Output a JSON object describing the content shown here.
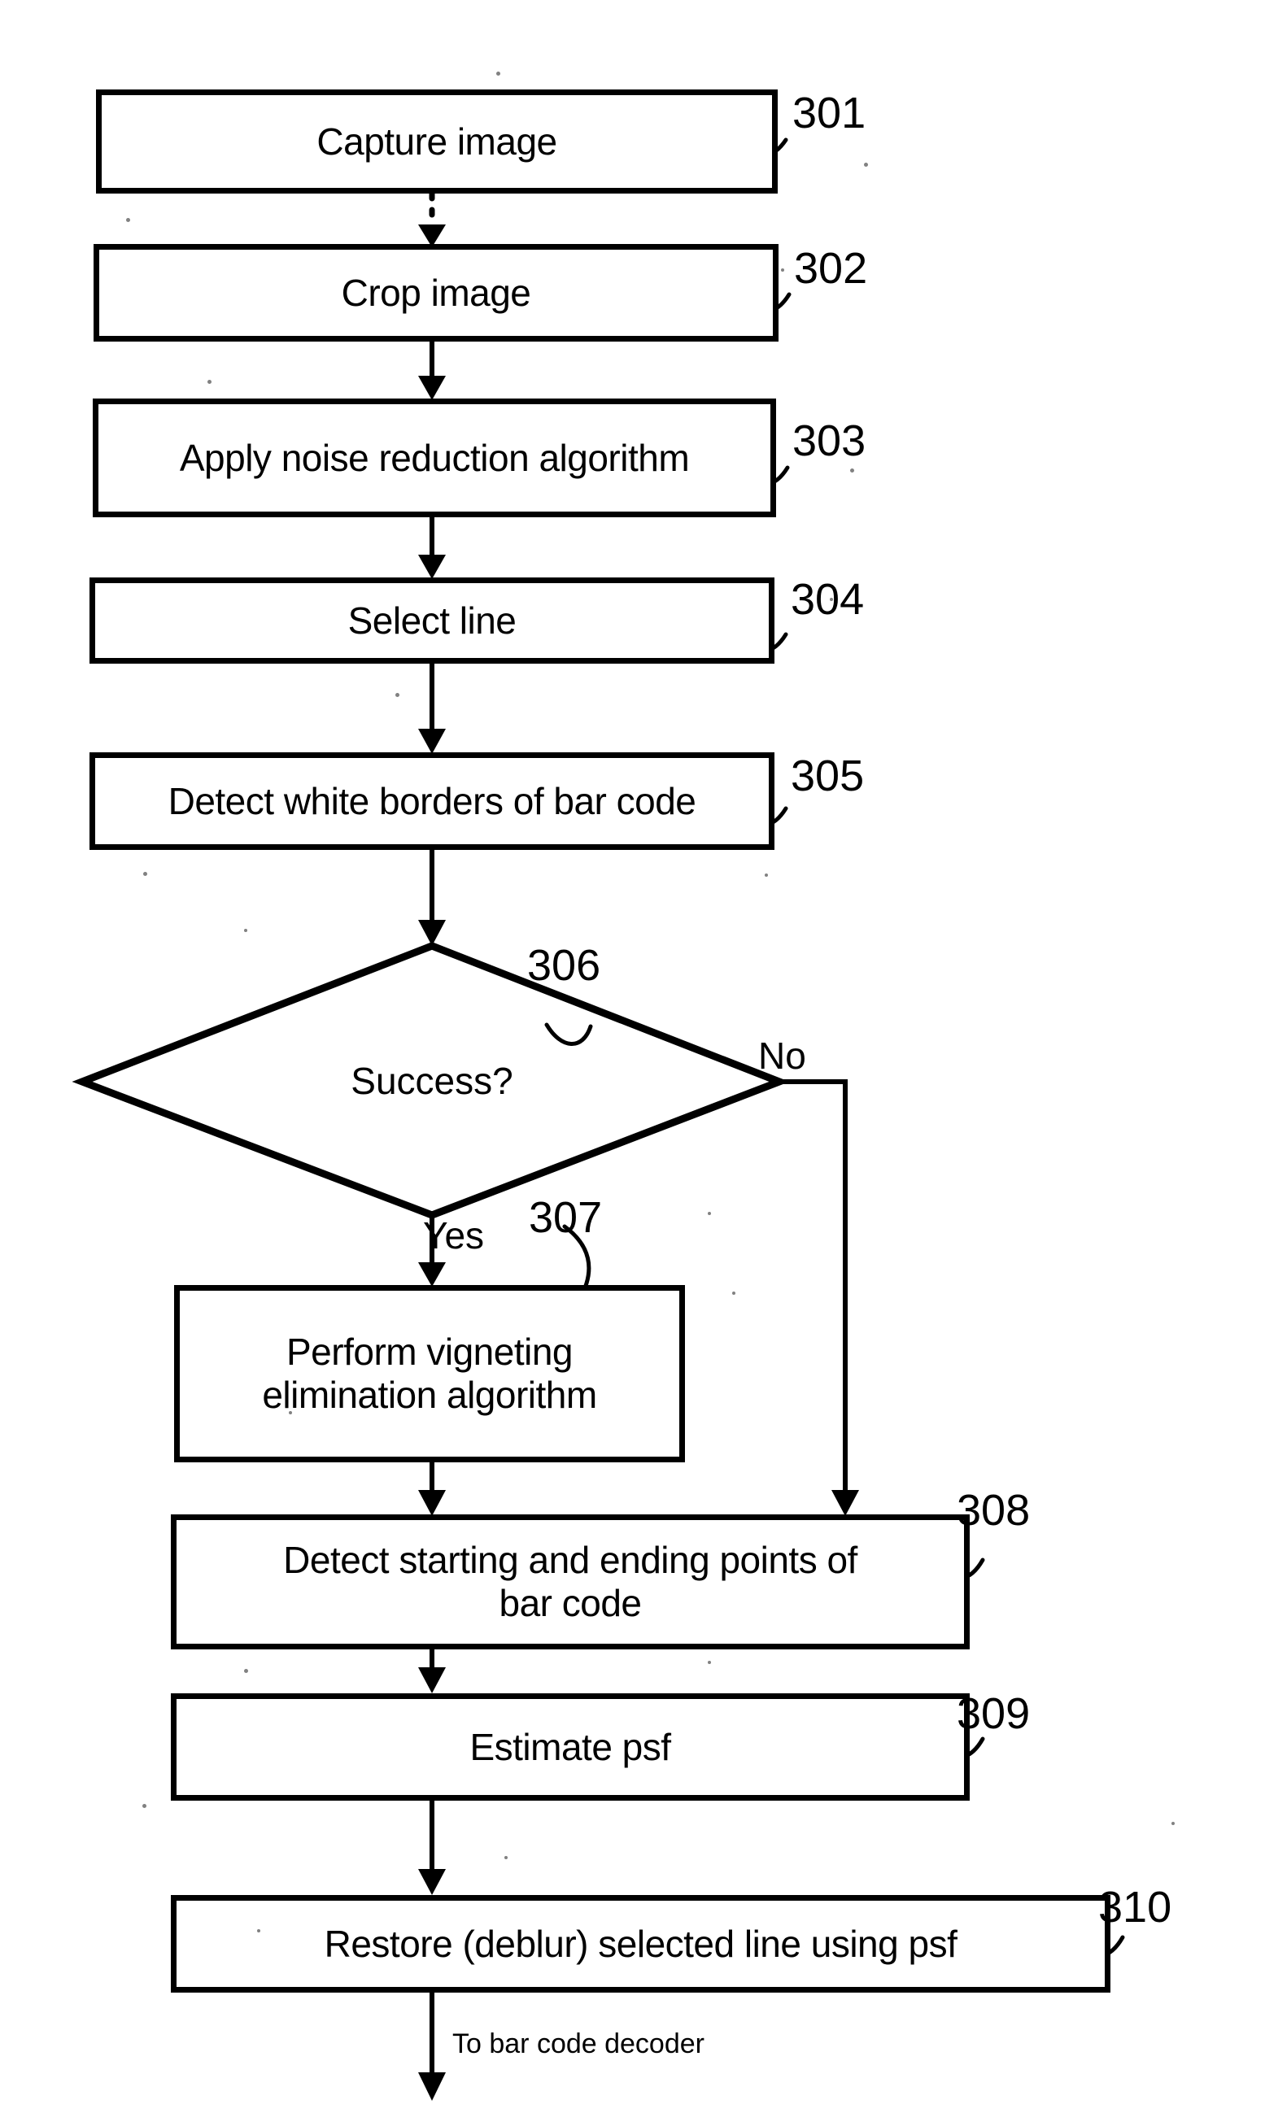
{
  "figure": {
    "type": "flowchart",
    "title": "Bar code image processing flowchart",
    "background_color": "#ffffff",
    "line_color": "#000000"
  },
  "nodes": [
    {
      "id": "301",
      "shape": "process",
      "label": "Capture image",
      "ref": "301"
    },
    {
      "id": "302",
      "shape": "process",
      "label": "Crop image",
      "ref": "302"
    },
    {
      "id": "303",
      "shape": "process",
      "label": "Apply noise reduction algorithm",
      "ref": "303"
    },
    {
      "id": "304",
      "shape": "process",
      "label": "Select line",
      "ref": "304"
    },
    {
      "id": "305",
      "shape": "process",
      "label": "Detect white borders of bar code",
      "ref": "305"
    },
    {
      "id": "306",
      "shape": "decision",
      "label": "Success?",
      "ref": "306"
    },
    {
      "id": "307",
      "shape": "process",
      "label": "Perform vigneting\nelimination algorithm",
      "ref": "307"
    },
    {
      "id": "308",
      "shape": "process",
      "label": "Detect starting and ending points of\nbar code",
      "ref": "308"
    },
    {
      "id": "309",
      "shape": "process",
      "label": "Estimate psf",
      "ref": "309"
    },
    {
      "id": "310",
      "shape": "process",
      "label": "Restore (deblur) selected line using psf",
      "ref": "310"
    }
  ],
  "edges": [
    {
      "from": "301",
      "to": "302",
      "style": "dotted",
      "label": ""
    },
    {
      "from": "302",
      "to": "303",
      "style": "solid",
      "label": ""
    },
    {
      "from": "303",
      "to": "304",
      "style": "solid",
      "label": ""
    },
    {
      "from": "304",
      "to": "305",
      "style": "solid",
      "label": ""
    },
    {
      "from": "305",
      "to": "306",
      "style": "solid",
      "label": ""
    },
    {
      "from": "306",
      "to": "307",
      "style": "solid",
      "label": "Yes"
    },
    {
      "from": "306",
      "to": "308",
      "style": "solid",
      "label": "No"
    },
    {
      "from": "307",
      "to": "308",
      "style": "solid",
      "label": ""
    },
    {
      "from": "308",
      "to": "309",
      "style": "solid",
      "label": ""
    },
    {
      "from": "309",
      "to": "310",
      "style": "solid",
      "label": ""
    },
    {
      "from": "310",
      "to": "decoder",
      "style": "solid",
      "label": "To bar code decoder"
    }
  ],
  "edge_labels": {
    "yes": "Yes",
    "no": "No",
    "terminal": "To bar code decoder"
  }
}
